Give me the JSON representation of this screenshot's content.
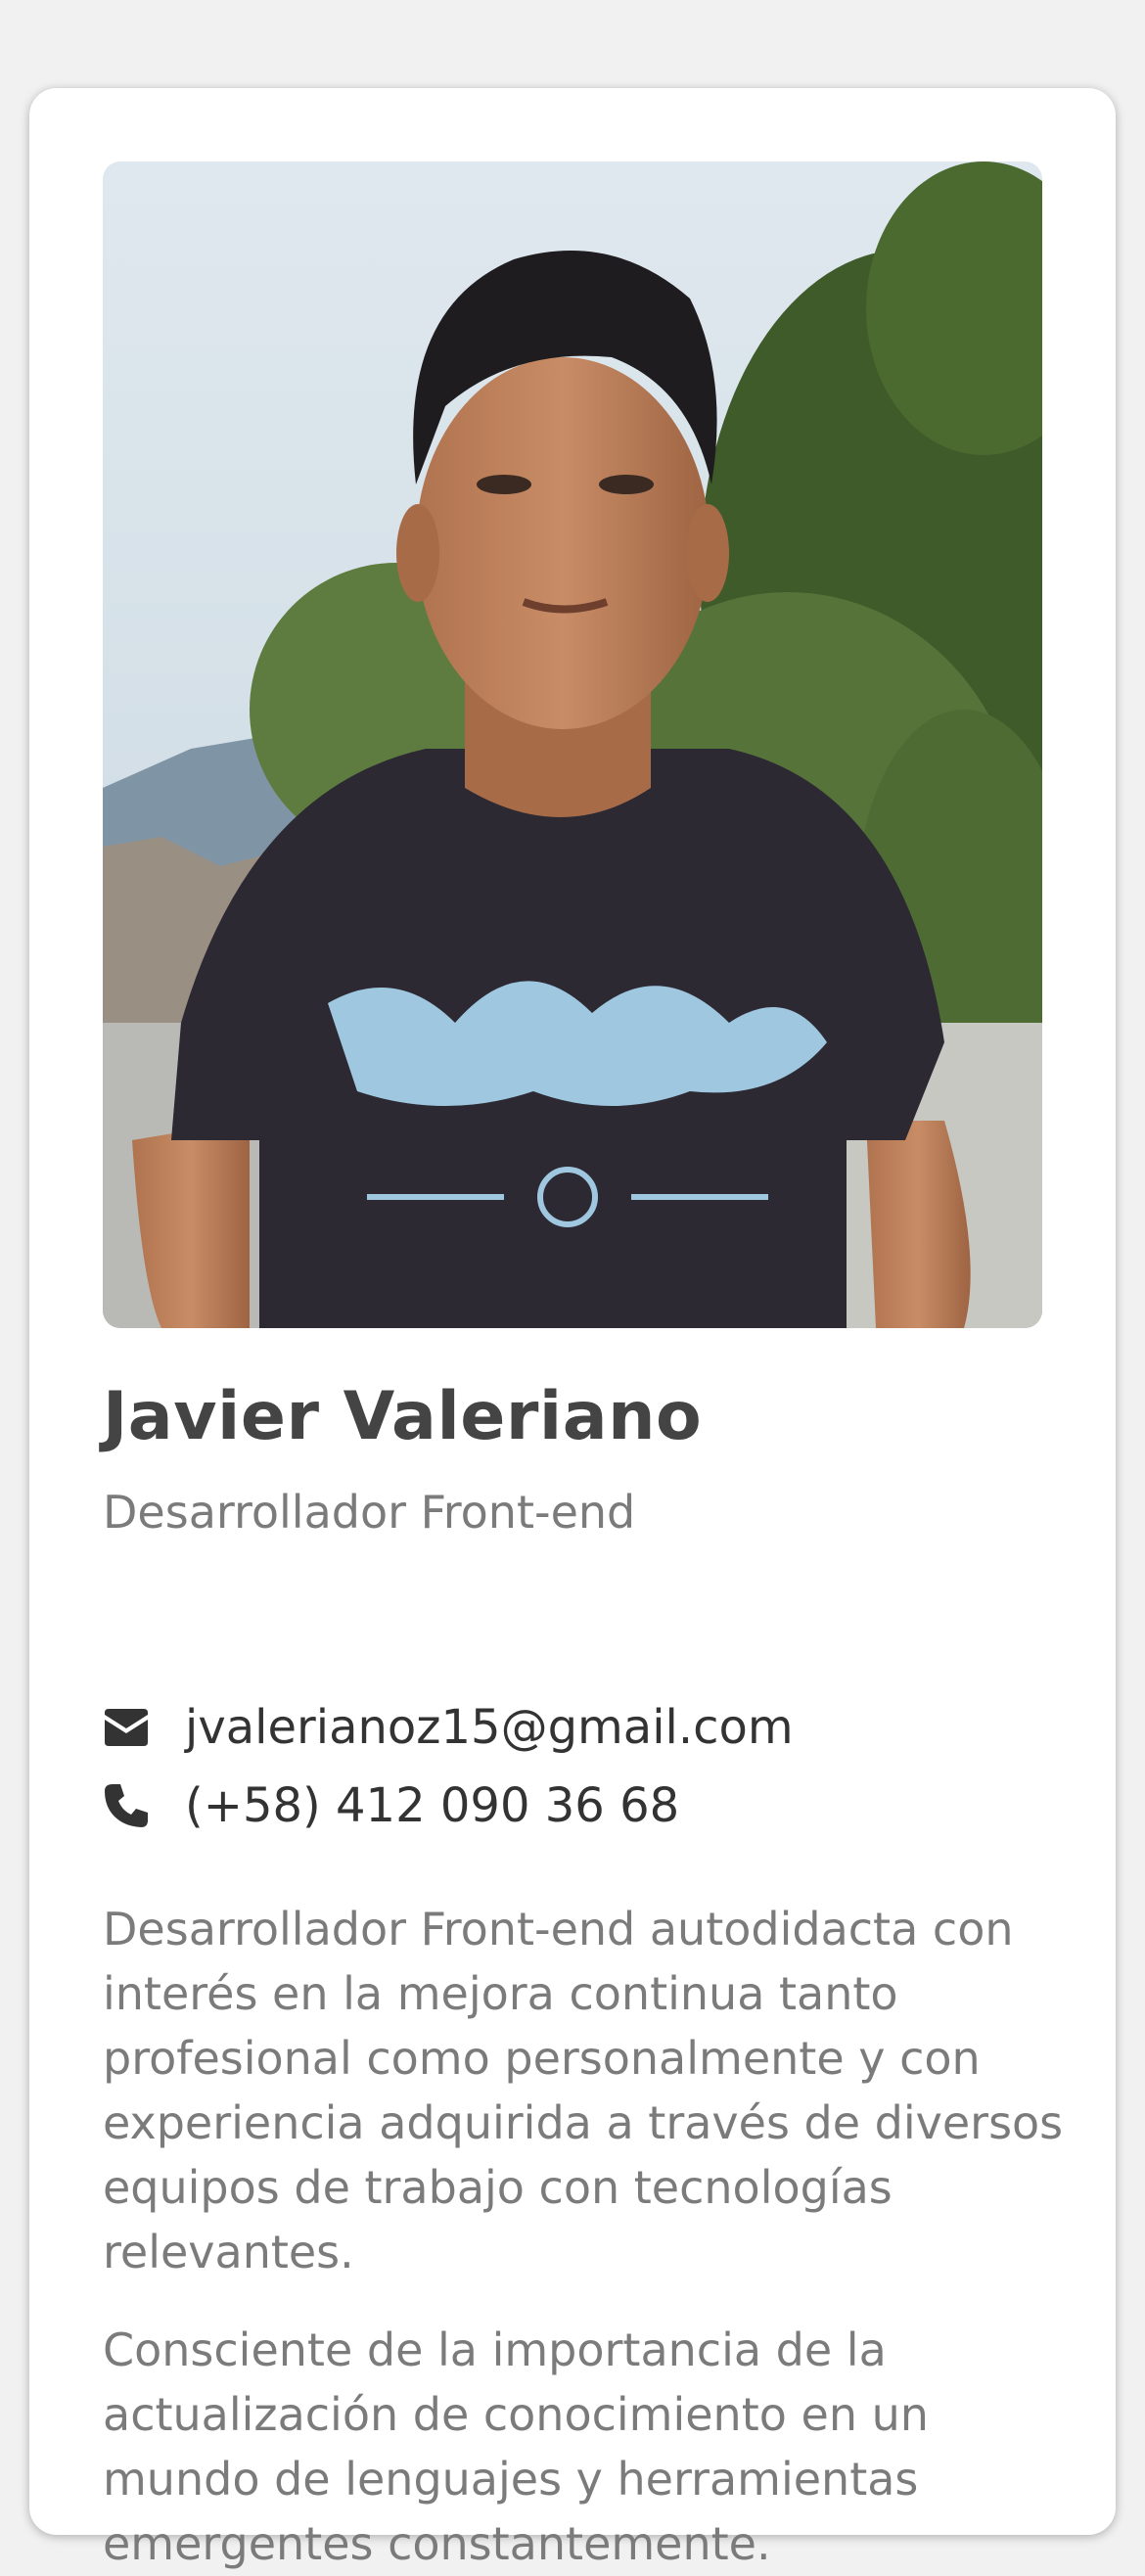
{
  "profile": {
    "photo_alt": "Javier Valeriano",
    "name": "Javier Valeriano",
    "role": "Desarrollador Front-end"
  },
  "contact": {
    "email": "jvalerianoz15@gmail.com",
    "phone": "(+58) 412 090 36 68",
    "email_icon": "envelope-icon",
    "phone_icon": "phone-icon"
  },
  "bio": {
    "paragraph_1": "Desarrollador Front-end autodidacta con interés en la mejora continua tanto profesional como personalmente y con experiencia adquirida a través de diversos equipos de trabajo con tecnologías relevantes.",
    "paragraph_2": "Consciente de la importancia de la actualización de conocimiento en un mundo de lenguajes y herramientas emergentes constantemente."
  },
  "colors": {
    "page_background": "#f1f1f1",
    "card_background": "#ffffff",
    "name_text": "#444444",
    "secondary_text": "#7b7b7b",
    "contact_text": "#333333"
  }
}
